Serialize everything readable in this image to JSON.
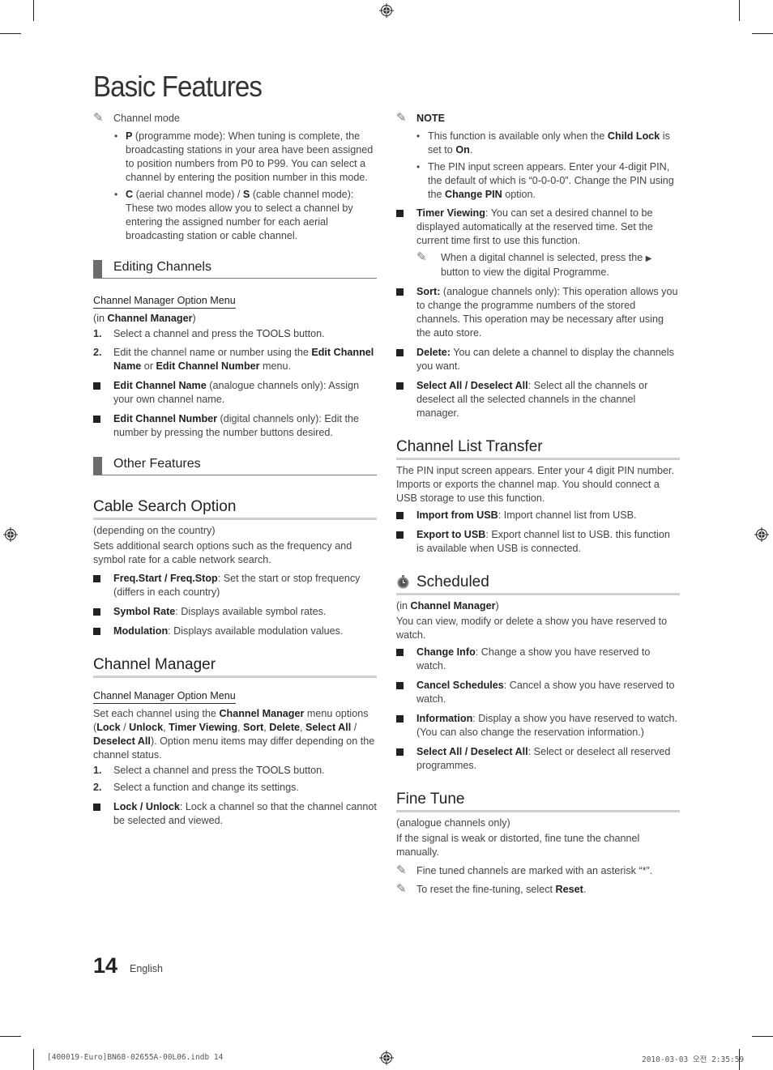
{
  "page": {
    "title": "Basic Features",
    "page_number": "14",
    "language": "English"
  },
  "slug": {
    "file": "[400019-Euro]BN68-02655A-00L06.indb   14",
    "timestamp": "2010-03-03   오전 2:35:59"
  },
  "icons": {
    "note": "pencil-icon",
    "scheduled": "stopwatch-icon",
    "registration": "registration-mark-icon",
    "play": "▶"
  },
  "left": {
    "channel_mode": {
      "label": "Channel mode",
      "items": [
        {
          "key": "P",
          "text": " (programme mode): When tuning is complete, the broadcasting stations in your area have been assigned to position numbers from P0 to P99. You can select a channel by entering the position number in this mode."
        },
        {
          "key": "C",
          "mid": " (aerial channel mode) / ",
          "key2": "S",
          "text": " (cable channel mode): These two modes allow you to select a channel by entering the assigned number for each aerial broadcasting station or cable channel."
        }
      ]
    },
    "editing": {
      "heading": "Editing Channels",
      "option_menu": "Channel Manager Option Menu",
      "in_prefix": "(in ",
      "in_bold": "Channel Manager",
      "in_suffix": ")",
      "steps": [
        {
          "n": "1.",
          "pre": "Select a channel and press the ",
          "bold": "TOOLS",
          "post": " button."
        },
        {
          "n": "2.",
          "pre": "Edit the channel name or number using the ",
          "bold": "Edit Channel Name",
          "mid": " or ",
          "bold2": "Edit Channel Number",
          "post": " menu."
        }
      ],
      "items": [
        {
          "bold": "Edit Channel Name",
          "text": " (analogue channels only): Assign your own channel name."
        },
        {
          "bold": "Edit Channel Number",
          "text": " (digital channels only): Edit the number by pressing the number buttons desired."
        }
      ]
    },
    "other": {
      "heading": "Other Features"
    },
    "cable": {
      "heading": "Cable Search Option",
      "qualifier": "(depending on the country)",
      "desc": "Sets additional search options such as the frequency and symbol rate for a cable network search.",
      "items": [
        {
          "bold": "Freq.Start / Freq.Stop",
          "text": ": Set the start or stop frequency (differs in each country)"
        },
        {
          "bold": "Symbol Rate",
          "text": ": Displays available symbol rates."
        },
        {
          "bold": "Modulation",
          "text": ": Displays available modulation values."
        }
      ]
    },
    "manager": {
      "heading": "Channel Manager",
      "option_menu": "Channel Manager Option Menu",
      "desc": [
        {
          "t": "Set each channel using the "
        },
        {
          "b": "Channel Manager"
        },
        {
          "t": " menu options ("
        },
        {
          "b": "Lock"
        },
        {
          "t": " / "
        },
        {
          "b": "Unlock"
        },
        {
          "t": ", "
        },
        {
          "b": "Timer Viewing"
        },
        {
          "t": ", "
        },
        {
          "b": "Sort"
        },
        {
          "t": ", "
        },
        {
          "b": "Delete"
        },
        {
          "t": ", "
        },
        {
          "b": "Select All"
        },
        {
          "t": " / "
        },
        {
          "b": "Deselect All"
        },
        {
          "t": "). Option menu items may differ depending on the channel status."
        }
      ],
      "steps": [
        {
          "n": "1.",
          "pre": "Select a channel and press the ",
          "bold": "TOOLS",
          "post": " button."
        },
        {
          "n": "2.",
          "pre": "Select a function and change its settings."
        }
      ],
      "items": [
        {
          "bold": "Lock / Unlock",
          "text": ": Lock a channel so that the channel cannot be selected and viewed."
        }
      ]
    }
  },
  "right": {
    "note": {
      "label": "NOTE",
      "bullets": [
        {
          "pre": "This function is available only when the ",
          "bold": "Child Lock",
          "mid": " is set to ",
          "bold2": "On",
          "post": "."
        },
        {
          "pre": "The PIN input screen appears. Enter your 4-digit PIN, the default of which is “0-0-0-0”. Change the PIN using the ",
          "bold": "Change PIN",
          "post": " option."
        }
      ]
    },
    "timer": {
      "bold": "Timer Viewing",
      "text": ": You can set a desired channel to be displayed automatically at the reserved time. Set the current time first to use this function.",
      "note_pre": "When a digital channel is selected, press the ",
      "note_post": " button to view the digital Programme."
    },
    "items": [
      {
        "bold": "Sort:",
        "text": " (analogue channels only): This operation allows you to change the programme numbers of the stored channels. This operation may be necessary after using the auto store."
      },
      {
        "bold": "Delete:",
        "text": " You can delete a channel to display the channels you want."
      },
      {
        "bold": "Select All / Deselect All",
        "text": ": Select all the channels or deselect all the selected channels in the channel manager."
      }
    ],
    "transfer": {
      "heading": "Channel List Transfer",
      "desc": "The PIN input screen appears. Enter your 4 digit PIN number. Imports or exports the channel map. You should connect a USB storage to use this function.",
      "items": [
        {
          "bold": "Import from USB",
          "text": ": Import channel list from USB."
        },
        {
          "bold": "Export to USB",
          "text": ": Export channel list to USB. this function is available when USB is connected."
        }
      ]
    },
    "scheduled": {
      "heading": "Scheduled",
      "in_prefix": "(in ",
      "in_bold": "Channel Manager",
      "in_suffix": ")",
      "desc": "You can view, modify or delete a show you have reserved to watch.",
      "items": [
        {
          "bold": "Change Info",
          "text": ": Change a show you have reserved to watch."
        },
        {
          "bold": "Cancel Schedules",
          "text": ": Cancel a show you have reserved to watch."
        },
        {
          "bold": "Information",
          "text": ": Display a show you have reserved to watch. (You can also change the reservation information.)"
        },
        {
          "bold": "Select All / Deselect All",
          "text": ": Select or deselect all reserved programmes."
        }
      ]
    },
    "finetune": {
      "heading": "Fine Tune",
      "qualifier": "(analogue channels only)",
      "desc": "If the signal is weak or distorted, fine tune the channel manually.",
      "note1": "Fine tuned channels are marked with an asterisk “*”.",
      "note2_pre": "To reset the fine-tuning, select ",
      "note2_bold": "Reset",
      "note2_post": "."
    }
  }
}
